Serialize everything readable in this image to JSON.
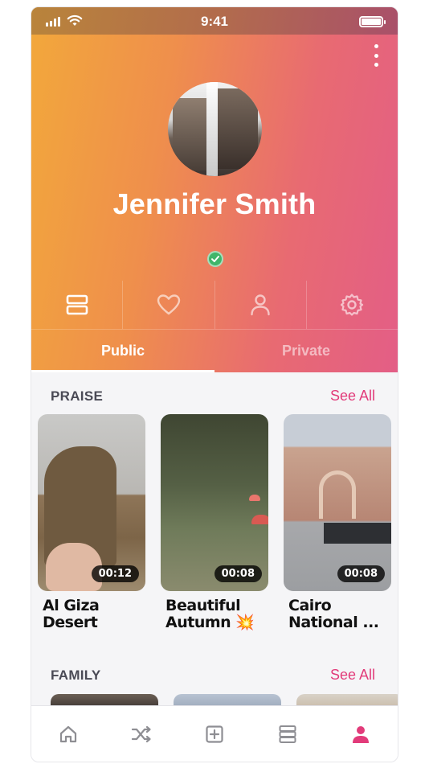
{
  "status_bar": {
    "time": "9:41"
  },
  "profile": {
    "name": "Jennifer Smith",
    "verified": true
  },
  "profile_icons": [
    "list-icon",
    "heart-icon",
    "person-icon",
    "gear-icon"
  ],
  "segment": {
    "tabs": [
      "Public",
      "Private"
    ],
    "active": "Public"
  },
  "sections": [
    {
      "title": "PRAISE",
      "see_all": "See All",
      "videos": [
        {
          "title": "Al Giza Desert",
          "duration": "00:12"
        },
        {
          "title": "Beautiful Autumn 💥",
          "duration": "00:08"
        },
        {
          "title": "Cairo National ...",
          "duration": "00:08"
        }
      ]
    },
    {
      "title": "FAMILY",
      "see_all": "See All"
    }
  ],
  "tab_bar": {
    "items": [
      "home-icon",
      "shuffle-icon",
      "add-icon",
      "list-icon",
      "profile-icon"
    ],
    "active": "profile-icon",
    "active_color": "#e23b7a",
    "inactive_color": "#8e8e93"
  },
  "colors": {
    "accent": "#e23b7a",
    "gradient_start": "#f2a83b",
    "gradient_end": "#e35e86",
    "verified": "#3fb56a"
  }
}
